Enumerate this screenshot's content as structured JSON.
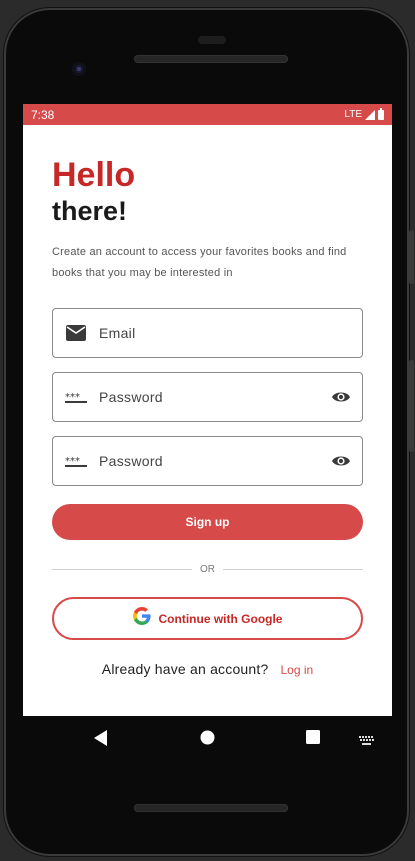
{
  "status_bar": {
    "time": "7:38",
    "network": "LTE"
  },
  "greeting": {
    "line1": "Hello",
    "line2": "there!"
  },
  "subtitle": "Create an account to access your favorites books and find books that you may be interested in",
  "form": {
    "email_placeholder": "Email",
    "password_placeholder": "Password",
    "confirm_password_placeholder": "Password"
  },
  "buttons": {
    "signup_label": "Sign up",
    "divider_label": "OR",
    "google_label": "Continue with Google"
  },
  "footer": {
    "question": "Already have an account?",
    "login_link": "Log in"
  },
  "icons": {
    "email": "mail-icon",
    "password": "password-dots-icon",
    "visibility": "eye-icon",
    "google": "google-g-icon"
  },
  "colors": {
    "accent": "#d64a4a",
    "title_red": "#c62828",
    "text_dark": "#1a1a1a"
  }
}
